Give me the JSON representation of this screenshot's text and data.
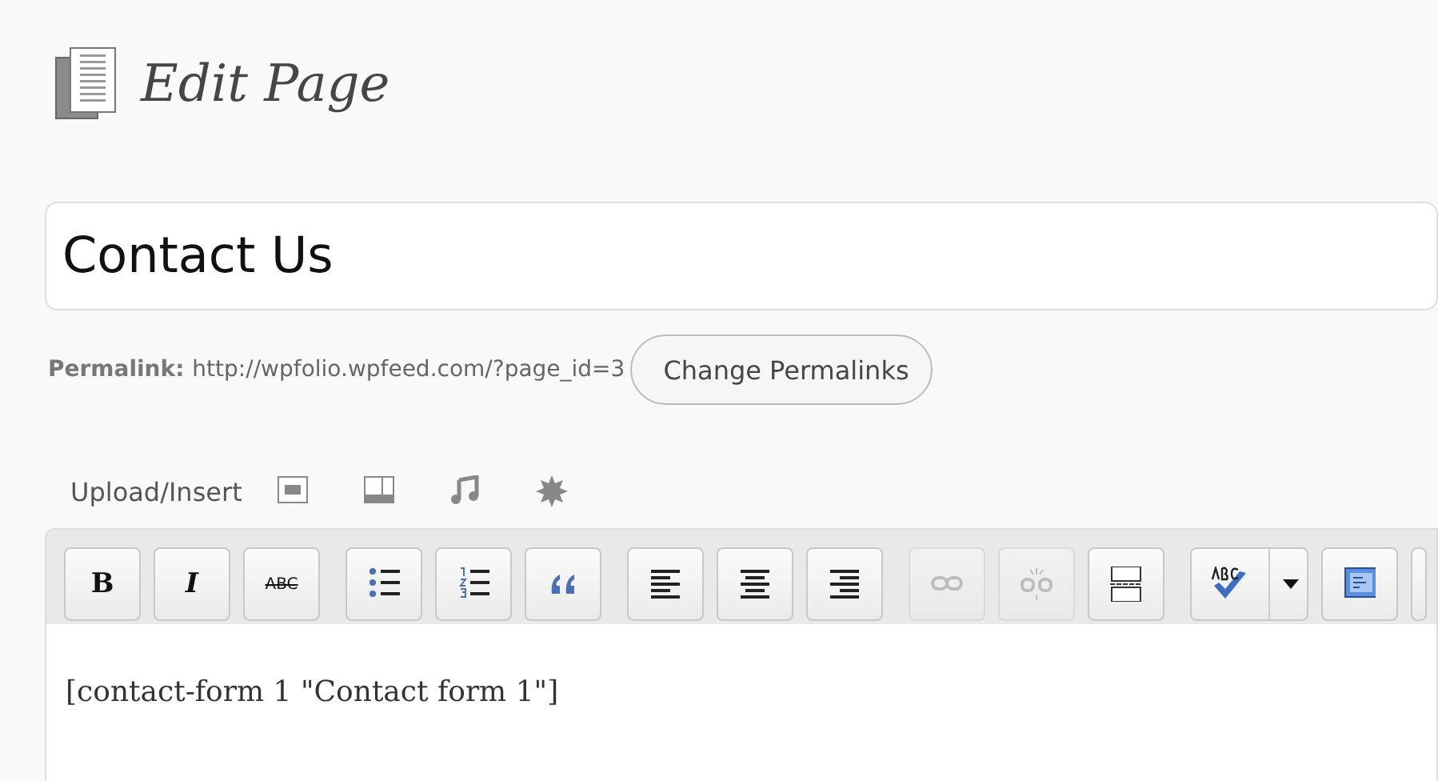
{
  "heading": {
    "title": "Edit Page"
  },
  "title_field": {
    "value": "Contact Us"
  },
  "permalink": {
    "label": "Permalink:",
    "url": "http://wpfolio.wpfeed.com/?page_id=3",
    "button": "Change Permalinks"
  },
  "upload_insert": {
    "label": "Upload/Insert"
  },
  "toolbar": {
    "groups": [
      [
        {
          "kind": "text",
          "label": "B",
          "disabled": false
        },
        {
          "kind": "text",
          "label": "I",
          "disabled": false
        },
        {
          "kind": "text",
          "label": "ABC",
          "disabled": false
        }
      ],
      [
        {
          "kind": "icon",
          "disabled": false
        },
        {
          "kind": "icon",
          "disabled": false
        },
        {
          "kind": "icon",
          "disabled": false
        }
      ],
      [
        {
          "kind": "icon",
          "disabled": false
        },
        {
          "kind": "icon",
          "disabled": false
        },
        {
          "kind": "icon",
          "disabled": false
        }
      ],
      [
        {
          "kind": "icon",
          "disabled": true
        },
        {
          "kind": "icon",
          "disabled": true
        },
        {
          "kind": "icon",
          "disabled": false
        }
      ],
      [
        {
          "kind": "split",
          "disabled": false
        },
        {
          "kind": "icon",
          "disabled": false
        },
        {
          "kind": "blank",
          "disabled": false
        }
      ]
    ]
  },
  "editor": {
    "content": "[contact-form 1 \"Contact form 1\"]"
  }
}
